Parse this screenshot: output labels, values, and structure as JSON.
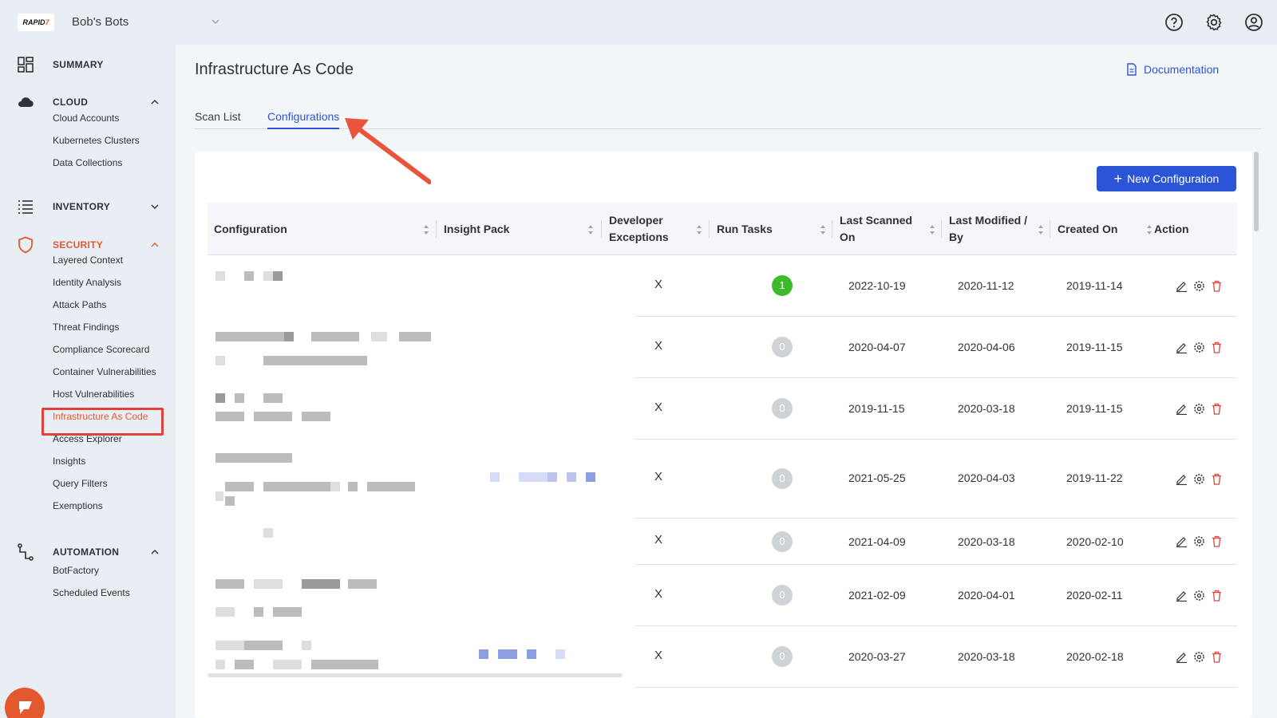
{
  "topbar": {
    "logo_text": "RAPID",
    "logo_accent": "7",
    "org_name": "Bob's Bots",
    "icons": [
      "help-icon",
      "settings-icon",
      "account-icon"
    ]
  },
  "sidebar": {
    "summary": {
      "label": "SUMMARY"
    },
    "cloud": {
      "label": "CLOUD",
      "items": [
        {
          "label": "Cloud Accounts"
        },
        {
          "label": "Kubernetes Clusters"
        },
        {
          "label": "Data Collections"
        }
      ]
    },
    "inventory": {
      "label": "INVENTORY"
    },
    "security": {
      "label": "SECURITY",
      "items": [
        {
          "label": "Layered Context"
        },
        {
          "label": "Identity Analysis"
        },
        {
          "label": "Attack Paths"
        },
        {
          "label": "Threat Findings"
        },
        {
          "label": "Compliance Scorecard"
        },
        {
          "label": "Container Vulnerabilities"
        },
        {
          "label": "Host Vulnerabilities"
        },
        {
          "label": "Infrastructure As Code"
        },
        {
          "label": "Access Explorer"
        },
        {
          "label": "Insights"
        },
        {
          "label": "Query Filters"
        },
        {
          "label": "Exemptions"
        }
      ]
    },
    "automation": {
      "label": "AUTOMATION",
      "items": [
        {
          "label": "BotFactory"
        },
        {
          "label": "Scheduled Events"
        }
      ]
    },
    "active_item": "Infrastructure As Code",
    "accent_color": "#e4582f"
  },
  "main": {
    "title": "Infrastructure As Code",
    "doc_link": "Documentation",
    "tabs": [
      {
        "label": "Scan List",
        "active": false
      },
      {
        "label": "Configurations",
        "active": true
      }
    ],
    "new_button": "New Configuration",
    "primary_color": "#2b55d6"
  },
  "table": {
    "columns": [
      {
        "label": "Configuration"
      },
      {
        "label": "Insight Pack"
      },
      {
        "label": "Developer Exceptions"
      },
      {
        "label": "Run Tasks"
      },
      {
        "label": "Last Scanned On"
      },
      {
        "label": "Last Modified / By"
      },
      {
        "label": "Created On"
      },
      {
        "label": "Action"
      }
    ],
    "rows": [
      {
        "developer_exceptions": "X",
        "run_tasks": "1",
        "last_scanned": "2022-10-19",
        "last_modified": "2020-11-12",
        "created_on": "2019-11-14"
      },
      {
        "developer_exceptions": "X",
        "run_tasks": "0",
        "last_scanned": "2020-04-07",
        "last_modified": "2020-04-06",
        "created_on": "2019-11-15"
      },
      {
        "developer_exceptions": "X",
        "run_tasks": "0",
        "last_scanned": "2019-11-15",
        "last_modified": "2020-03-18",
        "created_on": "2019-11-15"
      },
      {
        "developer_exceptions": "X",
        "run_tasks": "0",
        "last_scanned": "2021-05-25",
        "last_modified": "2020-04-03",
        "created_on": "2019-11-22"
      },
      {
        "developer_exceptions": "X",
        "run_tasks": "0",
        "last_scanned": "2021-04-09",
        "last_modified": "2020-03-18",
        "created_on": "2020-02-10"
      },
      {
        "developer_exceptions": "X",
        "run_tasks": "0",
        "last_scanned": "2021-02-09",
        "last_modified": "2020-04-01",
        "created_on": "2020-02-11"
      },
      {
        "developer_exceptions": "X",
        "run_tasks": "0",
        "last_scanned": "2020-03-27",
        "last_modified": "2020-03-18",
        "created_on": "2020-02-18"
      }
    ],
    "action_icons": [
      "edit-icon",
      "settings-icon",
      "delete-icon"
    ]
  }
}
